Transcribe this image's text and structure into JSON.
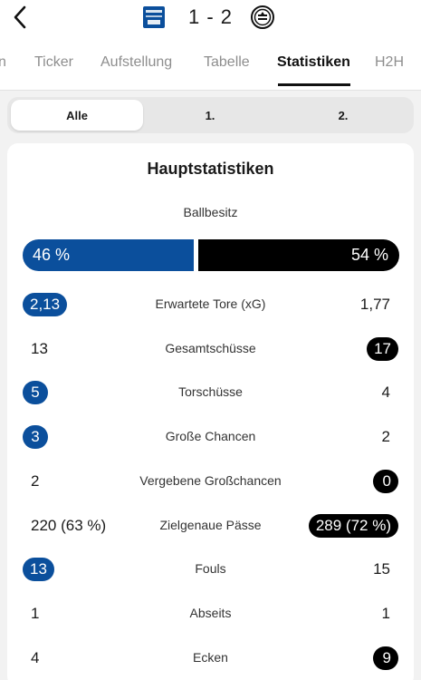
{
  "header": {
    "home_crest_text": "FC BLAU WEISS LINZ",
    "score": "1 - 2"
  },
  "tabs": [
    {
      "label": "n"
    },
    {
      "label": "Ticker"
    },
    {
      "label": "Aufstellung"
    },
    {
      "label": "Tabelle"
    },
    {
      "label": "Statistiken",
      "active": true
    },
    {
      "label": "H2H"
    }
  ],
  "segments": [
    {
      "label": "Alle",
      "active": true
    },
    {
      "label": "1."
    },
    {
      "label": "2."
    }
  ],
  "card": {
    "title": "Hauptstatistiken",
    "possession": {
      "label": "Ballbesitz",
      "home_text": "46 %",
      "away_text": "54 %",
      "home_percent": 46,
      "away_percent": 54
    },
    "stats": [
      {
        "label": "Erwartete Tore (xG)",
        "home": "2,13",
        "away": "1,77",
        "leader": "home"
      },
      {
        "label": "Gesamtschüsse",
        "home": "13",
        "away": "17",
        "leader": "away"
      },
      {
        "label": "Torschüsse",
        "home": "5",
        "away": "4",
        "leader": "home"
      },
      {
        "label": "Große Chancen",
        "home": "3",
        "away": "2",
        "leader": "home"
      },
      {
        "label": "Vergebene Großchancen",
        "home": "2",
        "away": "0",
        "leader": "away"
      },
      {
        "label": "Zielgenaue Pässe",
        "home": "220 (63 %)",
        "away": "289 (72 %)",
        "leader": "away"
      },
      {
        "label": "Fouls",
        "home": "13",
        "away": "15",
        "leader": "home"
      },
      {
        "label": "Abseits",
        "home": "1",
        "away": "1",
        "leader": "none"
      },
      {
        "label": "Ecken",
        "home": "4",
        "away": "9",
        "leader": "away"
      }
    ]
  },
  "colors": {
    "home": "#0b4f9c",
    "away": "#000000",
    "background": "#f2f2f2",
    "card": "#ffffff"
  },
  "icons": {
    "back": "chevron-left-icon",
    "home_crest": "blau-weiss-linz-crest-icon",
    "away_crest": "sturm-graz-crest-icon"
  }
}
